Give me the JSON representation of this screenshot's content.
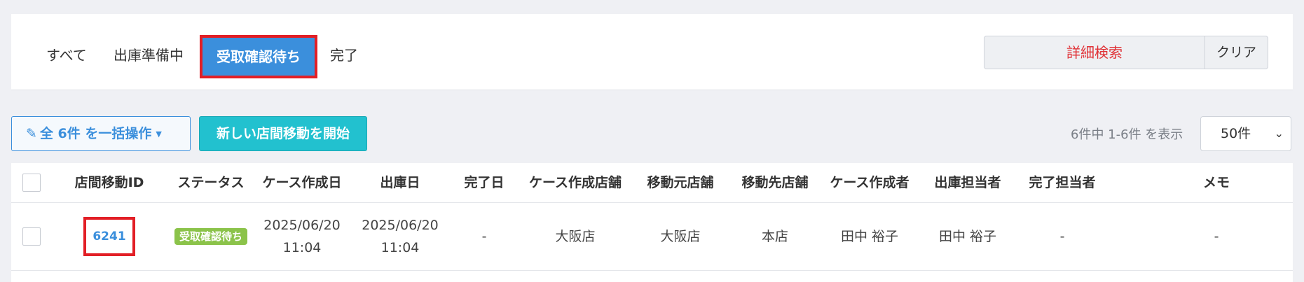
{
  "tabs": [
    {
      "label": "すべて"
    },
    {
      "label": "出庫準備中"
    },
    {
      "label": "受取確認待ち"
    },
    {
      "label": "完了"
    }
  ],
  "search": {
    "detail_label": "詳細検索",
    "clear_label": "クリア"
  },
  "toolbar": {
    "bulk_label": "全 6件 を一括操作",
    "new_label": "新しい店間移動を開始",
    "count_text": "6件中 1-6件 を表示",
    "per_page": "50件"
  },
  "table": {
    "headers": [
      "店間移動ID",
      "ステータス",
      "ケース作成日",
      "出庫日",
      "完了日",
      "ケース作成店舗",
      "移動元店舗",
      "移動先店舗",
      "ケース作成者",
      "出庫担当者",
      "完了担当者",
      "メモ"
    ],
    "rows": [
      {
        "id": "6241",
        "status": "受取確認待ち",
        "created_date": "2025/06/20",
        "created_time": "11:04",
        "shipped_date": "2025/06/20",
        "shipped_time": "11:04",
        "completed": "-",
        "creating_store": "大阪店",
        "from_store": "大阪店",
        "to_store": "本店",
        "creator": "田中 裕子",
        "shipper": "田中 裕子",
        "completer": "-",
        "memo": "-"
      }
    ]
  },
  "colors": {
    "accent": "#3b8fdc",
    "highlight": "#e21f26",
    "status_green": "#8bc34a",
    "teal": "#22c1cf"
  }
}
